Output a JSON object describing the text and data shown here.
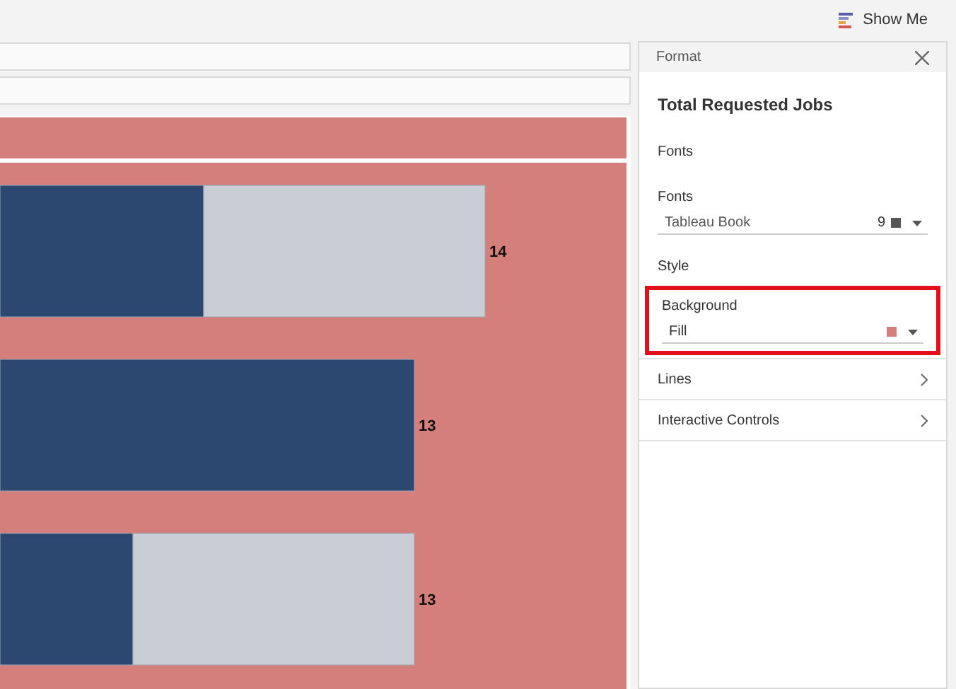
{
  "toolbar": {
    "show_me": "Show Me"
  },
  "chart": {
    "bars": [
      {
        "kind": "split",
        "label": "14"
      },
      {
        "kind": "full",
        "label": "13"
      },
      {
        "kind": "split",
        "label": "13"
      }
    ]
  },
  "format_panel": {
    "title": "Format",
    "heading": "Total Requested Jobs",
    "fonts_section": "Fonts",
    "fonts_field": {
      "label": "Fonts",
      "value": "Tableau Book",
      "size": "9",
      "color": "#555555"
    },
    "style_section": "Style",
    "background_field": {
      "label": "Background",
      "value": "Fill",
      "color": "#d47f7c",
      "highlighted": true
    },
    "nav_rows": [
      {
        "label": "Lines"
      },
      {
        "label": "Interactive Controls"
      }
    ]
  }
}
